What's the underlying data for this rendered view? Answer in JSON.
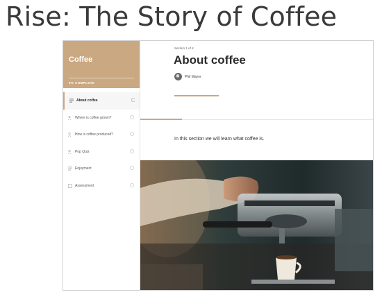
{
  "page": {
    "headline": "Rise: The Story of Coffee"
  },
  "sidebar": {
    "course_title": "Coffee",
    "progress_text": "0% COMPLETE",
    "lessons": [
      {
        "label": "About coffee",
        "icon": "text-lines-icon",
        "active": true,
        "status": "in-progress"
      },
      {
        "label": "Where is coffee grown?",
        "icon": "people-icon",
        "active": false,
        "status": "not-started"
      },
      {
        "label": "How is coffee produced?",
        "icon": "people-icon",
        "active": false,
        "status": "not-started"
      },
      {
        "label": "Pop Quiz",
        "icon": "people-icon",
        "active": false,
        "status": "not-started"
      },
      {
        "label": "Enjoyment",
        "icon": "text-lines-icon",
        "active": false,
        "status": "not-started"
      },
      {
        "label": "Assessment",
        "icon": "checkbox-icon",
        "active": false,
        "status": "not-started"
      }
    ]
  },
  "main": {
    "section_label": "Section 1 of 6",
    "title": "About coffee",
    "author": "Phil Mayor",
    "intro": "In this section we will learn what coffee is."
  },
  "colors": {
    "accent": "#c9a882",
    "text": "#2b2b2b"
  }
}
